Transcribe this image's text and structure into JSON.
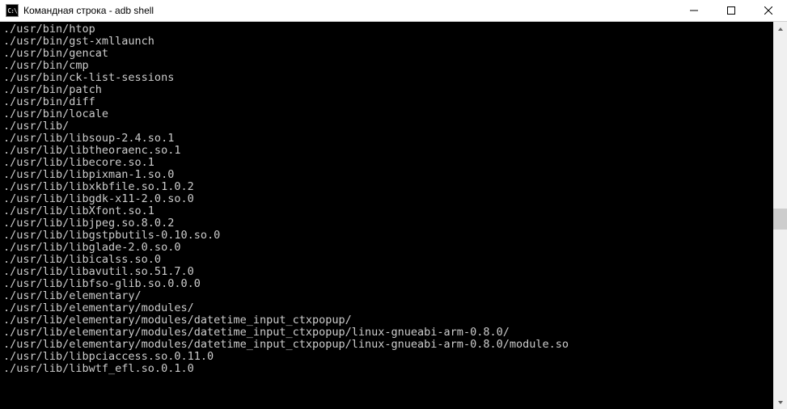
{
  "window": {
    "icon_text": "C:\\",
    "title": "Командная строка - adb  shell"
  },
  "terminal": {
    "lines": [
      "./usr/bin/htop",
      "./usr/bin/gst-xmllaunch",
      "./usr/bin/gencat",
      "./usr/bin/cmp",
      "./usr/bin/ck-list-sessions",
      "./usr/bin/patch",
      "./usr/bin/diff",
      "./usr/bin/locale",
      "./usr/lib/",
      "./usr/lib/libsoup-2.4.so.1",
      "./usr/lib/libtheoraenc.so.1",
      "./usr/lib/libecore.so.1",
      "./usr/lib/libpixman-1.so.0",
      "./usr/lib/libxkbfile.so.1.0.2",
      "./usr/lib/libgdk-x11-2.0.so.0",
      "./usr/lib/libXfont.so.1",
      "./usr/lib/libjpeg.so.8.0.2",
      "./usr/lib/libgstpbutils-0.10.so.0",
      "./usr/lib/libglade-2.0.so.0",
      "./usr/lib/libicalss.so.0",
      "./usr/lib/libavutil.so.51.7.0",
      "./usr/lib/libfso-glib.so.0.0.0",
      "./usr/lib/elementary/",
      "./usr/lib/elementary/modules/",
      "./usr/lib/elementary/modules/datetime_input_ctxpopup/",
      "./usr/lib/elementary/modules/datetime_input_ctxpopup/linux-gnueabi-arm-0.8.0/",
      "./usr/lib/elementary/modules/datetime_input_ctxpopup/linux-gnueabi-arm-0.8.0/module.so",
      "./usr/lib/libpciaccess.so.0.11.0",
      "./usr/lib/libwtf_efl.so.0.1.0"
    ]
  },
  "scrollbar": {
    "thumb_top_pct": 48,
    "thumb_height_pct": 6
  }
}
